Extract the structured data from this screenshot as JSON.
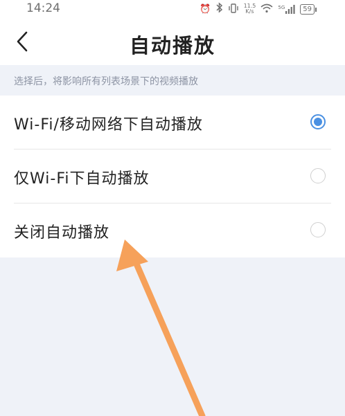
{
  "status_bar": {
    "time": "14:24",
    "net_speed_value": "11.5",
    "net_speed_unit": "K/s",
    "signal_label": "5G",
    "battery": "59",
    "icons": [
      "alarm-icon",
      "bluetooth-icon",
      "vibrate-icon",
      "network-speed",
      "wifi-icon",
      "signal-icon",
      "battery-icon"
    ]
  },
  "header": {
    "title": "自动播放",
    "back_icon": "chevron-left-icon"
  },
  "hint": "选择后，将影响所有列表场景下的视频播放",
  "options": [
    {
      "label": "Wi-Fi/移动网络下自动播放",
      "selected": true
    },
    {
      "label": "仅Wi-Fi下自动播放",
      "selected": false
    },
    {
      "label": "关闭自动播放",
      "selected": false
    }
  ],
  "colors": {
    "accent": "#4a90e2",
    "annotation_arrow": "#f6a15a",
    "background": "#eff2f8"
  }
}
